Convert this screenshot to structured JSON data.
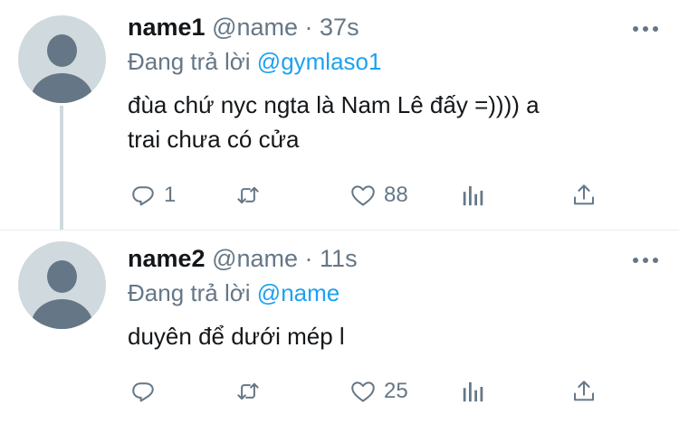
{
  "replying_prefix": "Đang trả lời",
  "tweets": [
    {
      "name": "name1",
      "handle": "@name",
      "time": "· 37s",
      "replying_to": "@gymlaso1",
      "text_line1": "đùa chứ nyc ngta là Nam Lê đấy =)))) a",
      "text_line2": "trai chưa có cửa",
      "reply_count": "1",
      "retweet_count": "",
      "like_count": "88"
    },
    {
      "name": "name2",
      "handle": "@name",
      "time": "· 11s",
      "replying_to": "@name",
      "text_line1": "duyên để dưới mép l",
      "reply_count": "",
      "retweet_count": "",
      "like_count": "25"
    }
  ],
  "icons": {
    "reply": "reply-bubble-icon",
    "retweet": "retweet-icon",
    "like": "heart-icon",
    "analytics": "bar-chart-icon",
    "share": "share-upload-icon",
    "more": "more-dots-icon"
  },
  "colors": {
    "text": "#14171a",
    "secondary": "#657786",
    "link": "#1da1f2",
    "avatar_bg": "#cfd9de"
  }
}
